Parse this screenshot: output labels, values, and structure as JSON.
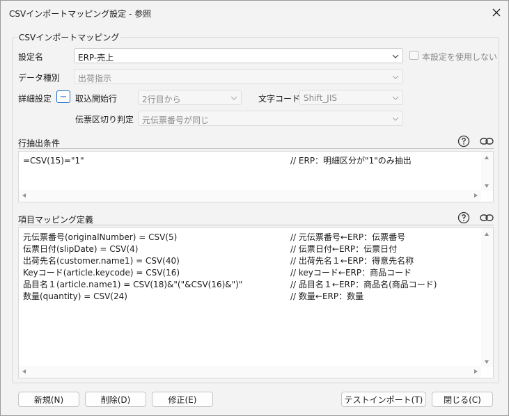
{
  "window": {
    "title": "CSVインポートマッピング設定 - 参照"
  },
  "group": {
    "title": "CSVインポートマッピング"
  },
  "settings": {
    "name_label": "設定名",
    "name_value": "ERP-売上",
    "unused_label": "本設定を使用しない",
    "data_type_label": "データ種別",
    "data_type_value": "出荷指示",
    "detail_label": "詳細設定",
    "detail_toggle": "−",
    "start_row_label": "取込開始行",
    "start_row_value": "2行目から",
    "charset_label": "文字コード",
    "charset_value": "Shift_JIS",
    "slip_label": "伝票区切り判定",
    "slip_value": "元伝票番号が同じ"
  },
  "row_filter": {
    "title": "行抽出条件",
    "lines": [
      {
        "code": "=CSV(15)=\"1\"",
        "comment": "// ERP：明細区分が\"1\"のみ抽出"
      }
    ]
  },
  "mapping": {
    "title": "項目マッピング定義",
    "lines": [
      {
        "code": "元伝票番号(originalNumber) = CSV(5)",
        "comment": "// 元伝票番号←ERP：伝票番号"
      },
      {
        "code": "伝票日付(slipDate) = CSV(4)",
        "comment": "// 伝票日付←ERP：伝票日付"
      },
      {
        "code": "出荷先名(customer.name1) = CSV(40)",
        "comment": "// 出荷先名１←ERP：得意先名称"
      },
      {
        "code": "Keyコード(article.keycode) = CSV(16)",
        "comment": "// keyコード←ERP：商品コード"
      },
      {
        "code": "品目名１(article.name1) = CSV(18)&\"(\"&CSV(16)&\")\"",
        "comment": "// 品目名１←ERP：商品名(商品コード)"
      },
      {
        "code": "数量(quantity) = CSV(24)",
        "comment": "// 数量←ERP：数量"
      }
    ]
  },
  "buttons": {
    "new": "新規(N)",
    "delete": "削除(D)",
    "edit": "修正(E)",
    "test_import": "テストインポート(T)",
    "close": "閉じる(C)"
  },
  "colors": {
    "accent": "#1a6fc4",
    "window_bg": "#f3f3f3"
  }
}
